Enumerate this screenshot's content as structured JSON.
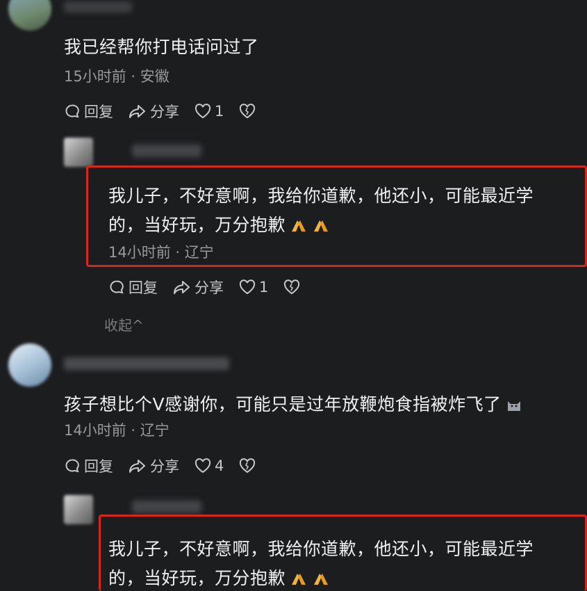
{
  "comments": [
    {
      "text": "我已经帮你打电话问过了",
      "time": "15小时前",
      "location": "安徽",
      "reply_label": "回复",
      "share_label": "分享",
      "likes": "1"
    },
    {
      "text_line1": "我儿子，不好意啊，我给你道歉，他还小，可能最近学",
      "text_line2": "的，当好玩，万分抱歉",
      "time": "14小时前",
      "location": "辽宁",
      "reply_label": "回复",
      "share_label": "分享",
      "likes": "1"
    },
    {
      "text": "孩子想比个V感谢你，可能只是过年放鞭炮食指被炸飞了",
      "time": "14小时前",
      "location": "辽宁",
      "reply_label": "回复",
      "share_label": "分享",
      "likes": "4"
    },
    {
      "text_line1": "我儿子，不好意啊，我给你道歉，他还小，可能最近学",
      "text_line2": "的，当好玩，万分抱歉"
    }
  ],
  "collapse_label": "收起^",
  "separator": " · ",
  "icons": {
    "reply": "comment-bubble-icon",
    "share": "share-arrow-icon",
    "like": "heart-icon",
    "dislike": "broken-heart-icon",
    "emoji": "praying-hands-icon",
    "sticker": "cat-sticker-icon"
  },
  "colors": {
    "background": "#1c1d1f",
    "highlight_box": "#d7261b",
    "meta_text": "#9a9a9a"
  }
}
